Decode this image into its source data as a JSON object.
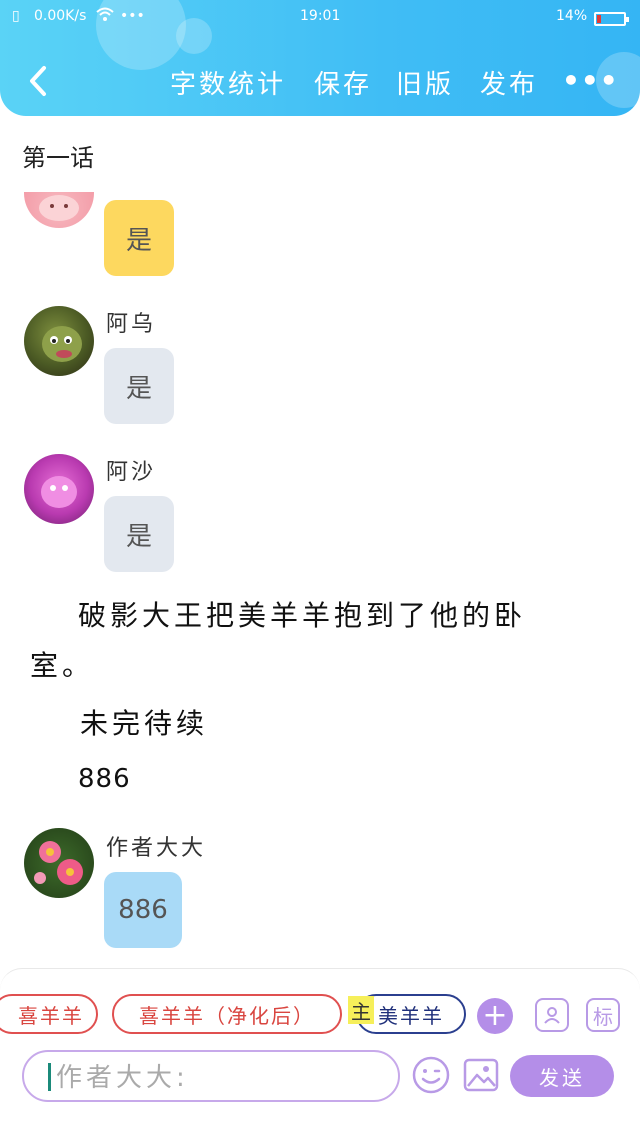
{
  "status_bar": {
    "speed": "0.00K/s",
    "dots": "•••",
    "time": "19:01",
    "battery": "14%",
    "battery_level": 0.14,
    "battery_color": "#e53935"
  },
  "toolbar": {
    "back_icon": "chevron-left-icon",
    "word_count": "字数统计",
    "save": "保存",
    "old_version": "旧版",
    "publish": "发布",
    "more": "•••",
    "gradient": [
      "#5ad3f6",
      "#35b5f4"
    ]
  },
  "chapter_title": "第一话",
  "messages": [
    {
      "text": "是",
      "bubble_color": "#fdd85f"
    },
    {
      "name": "阿乌",
      "text": "是",
      "bubble_color": "#e3e8ef"
    },
    {
      "name": "阿沙",
      "text": "是",
      "bubble_color": "#e3e8ef"
    }
  ],
  "narration": {
    "line1": "破影大王把美羊羊抱到了他的卧",
    "line2": "室。",
    "line3": "未完待续",
    "line4": "886"
  },
  "author_message": {
    "name": "作者大大",
    "text": "886",
    "bubble_color": "#a9daf7"
  },
  "characters": {
    "chip1": "喜羊羊",
    "chip2": "喜羊羊（净化后）",
    "chip3_tag": "主",
    "chip3": "美羊羊"
  },
  "composer": {
    "add_icon": "+",
    "role_icon": "person-card-icon",
    "tag_button": "标",
    "placeholder": "作者大大:",
    "emoji_icon": "smiley-icon",
    "image_icon": "image-icon",
    "send": "发送",
    "accent": "#b48ee8"
  }
}
